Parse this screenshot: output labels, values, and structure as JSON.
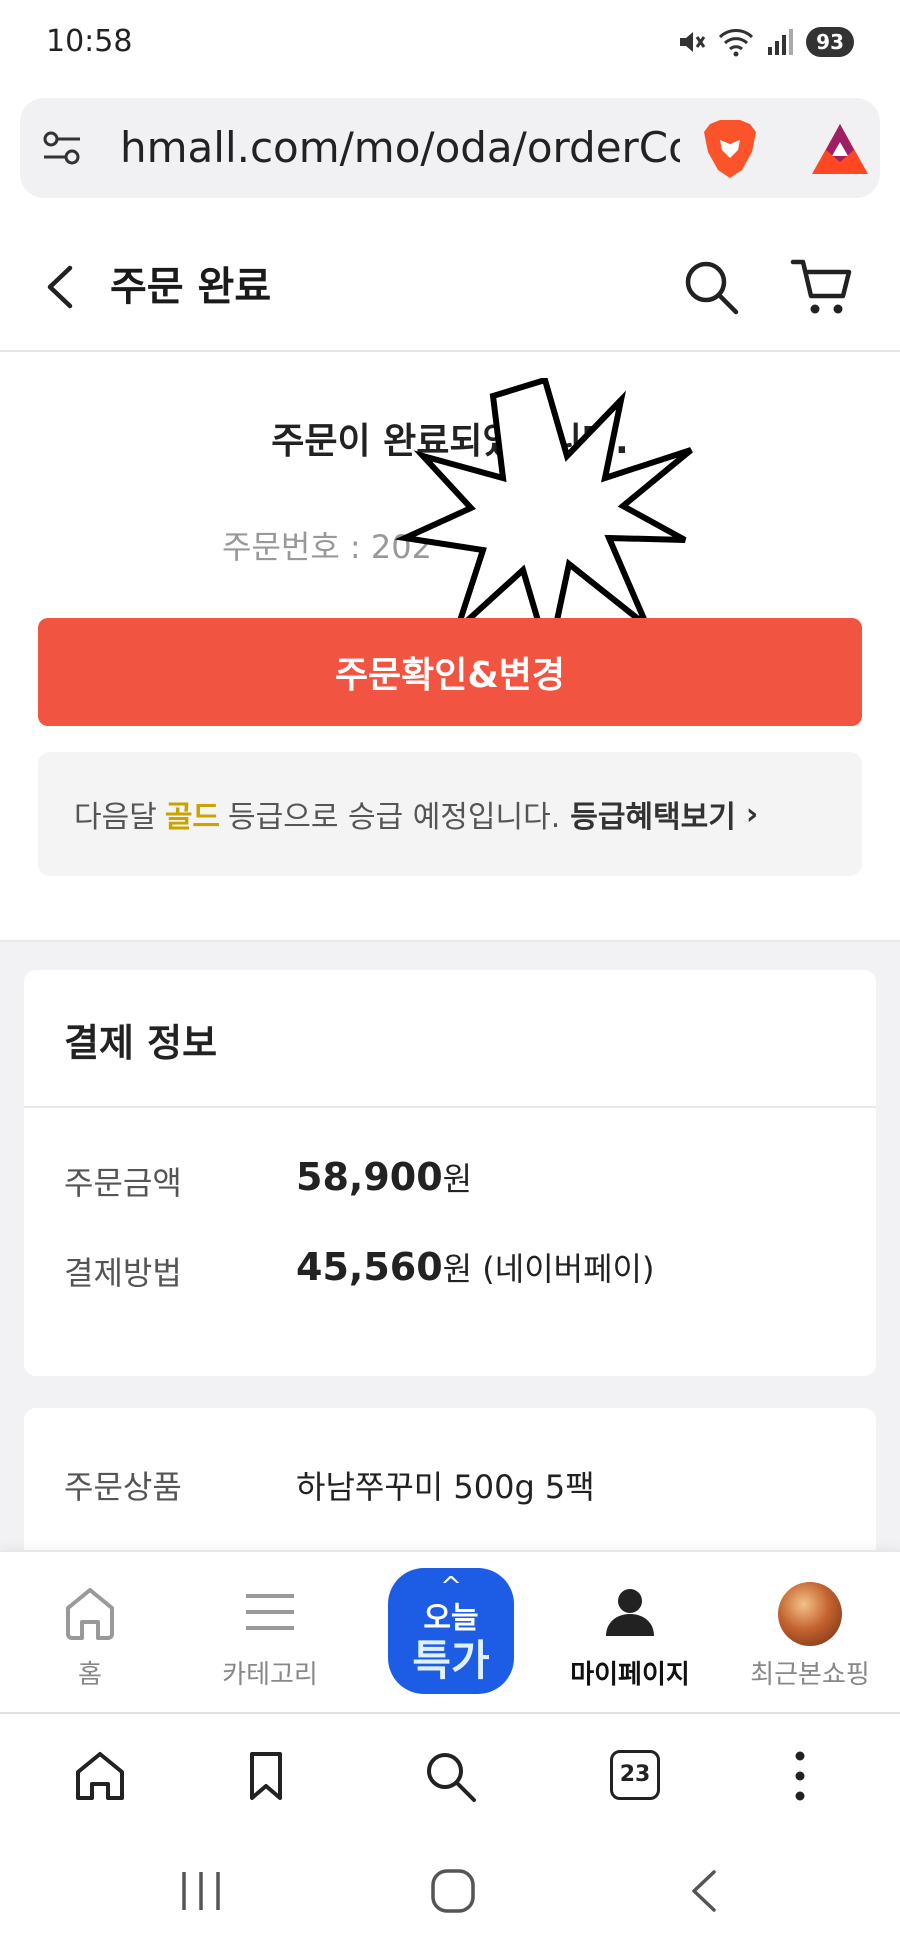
{
  "status_bar": {
    "time": "10:58",
    "battery": "93"
  },
  "browser": {
    "url": "hmall.com/mo/oda/orderCo",
    "tab_count": "23"
  },
  "header": {
    "title": "주문 완료"
  },
  "completion": {
    "message": "주문이 완료되었습니다.",
    "order_number": "주문번호 : 202",
    "primary_button": "주문확인&변경"
  },
  "grade_notice": {
    "prefix": "다음달",
    "grade": "골드",
    "suffix": "등급으로 승급 예정입니다.",
    "link": "등급혜택보기",
    "arrow": "›"
  },
  "payment_info": {
    "title": "결제 정보",
    "rows": [
      {
        "label": "주문금액",
        "amount": "58,900",
        "unit": "원",
        "extra": ""
      },
      {
        "label": "결제방법",
        "amount": "45,560",
        "unit": "원",
        "extra": "(네이버페이)"
      }
    ]
  },
  "order_items": {
    "label": "주문상품",
    "product": "하남쭈꾸미 500g 5팩"
  },
  "app_nav": {
    "items": [
      {
        "label": "홈",
        "icon": "home-icon"
      },
      {
        "label": "카테고리",
        "icon": "menu-icon"
      },
      {
        "label": "마이페이지",
        "icon": "person-icon",
        "active": true
      },
      {
        "label": "최근본쇼핑",
        "icon": "recent-thumbnail"
      }
    ],
    "today_deal": {
      "top": "오늘",
      "bottom": "특가"
    }
  },
  "colors": {
    "accent": "#f25442",
    "gold": "#c9a400",
    "today_deal_bg": "#1d5de6"
  }
}
